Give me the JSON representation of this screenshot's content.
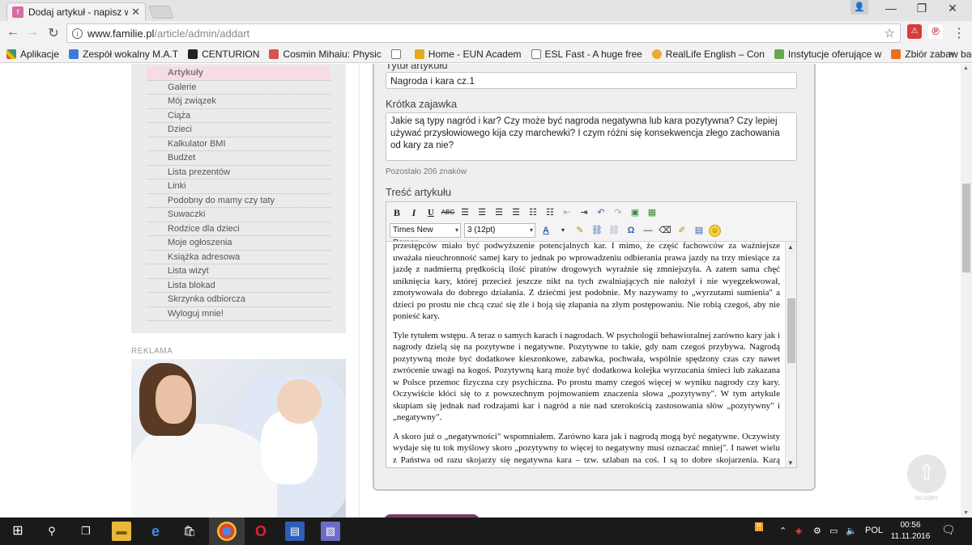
{
  "browser": {
    "tab_title": "Dodaj artykuł - napisz wł",
    "url_host": "www.familie.pl",
    "url_path": "/article/admin/addart",
    "bookmarks": [
      {
        "label": "Aplikacje",
        "color": "#e0513c"
      },
      {
        "label": "Zespół wokalny M.A.T",
        "color": "#3d7bd9"
      },
      {
        "label": "CENTURION",
        "color": "#222222"
      },
      {
        "label": "Cosmin Mihaiu: Physic",
        "color": "#d9534f"
      },
      {
        "label": "",
        "color": "#ffffff"
      },
      {
        "label": "Home - EUN Academ",
        "color": "#e6a91c"
      },
      {
        "label": "ESL Fast - A huge free",
        "color": "#ffffff"
      },
      {
        "label": "RealLife English – Con",
        "color": "#f0a73a"
      },
      {
        "label": "Instytucje oferujące w",
        "color": "#6aa84f"
      },
      {
        "label": "Zbiór zabaw badawcz",
        "color": "#e8711f"
      }
    ],
    "bookmarks_more": "»"
  },
  "sidebar": {
    "items": [
      {
        "label": "Artykuły",
        "active": true
      },
      {
        "label": "Galerie"
      },
      {
        "label": "Mój związek"
      },
      {
        "label": "Ciąża"
      },
      {
        "label": "Dzieci"
      },
      {
        "label": "Kalkulator BMI"
      },
      {
        "label": "Budżet"
      },
      {
        "label": "Lista prezentów"
      },
      {
        "label": "Linki"
      },
      {
        "label": "Podobny do mamy czy taty"
      },
      {
        "label": "Suwaczki"
      },
      {
        "label": "Rodzice dla dzieci"
      },
      {
        "label": "Moje ogłoszenia"
      },
      {
        "label": "Książka adresowa"
      },
      {
        "label": "Lista wizyt"
      },
      {
        "label": "Lista blokad"
      },
      {
        "label": "Skrzynka odbiorcza"
      },
      {
        "label": "Wyloguj mnie!"
      }
    ],
    "ad_label": "REKLAMA"
  },
  "form": {
    "title_label": "Tytuł artykułu",
    "title_value": "Nagroda i kara cz.1",
    "teaser_label": "Krótka zajawka",
    "teaser_value": "Jakie są typy nagród i kar? Czy może być nagroda negatywna lub kara pozytywna? Czy lepiej używać przysłowiowego kija czy marchewki? I czym różni się konsekwencja złego zachowania od kary za nie?",
    "counter": "Pozostało 206 znaków",
    "content_label": "Treść artykułu",
    "font_family": "Times New Roman",
    "font_size": "3 (12pt)",
    "paragraphs": [
      "przestępców miało być podwyższenie potencjalnych kar. I mimo, że część fachowców za ważniejsze uważała nieuchronność samej kary to jednak po wprowadzeniu odbierania prawa jazdy na trzy miesiące za jazdę z nadmierną prędkością ilość piratów drogowych wyraźnie się zmniejszyła. A zatem sama chęć uniknięcia kary, której przecież jeszcze nikt na tych zwalniających nie nałożył i nie wyegzekwował, zmotywowała do dobrego działania. Z dziećmi jest podobnie. My nazywamy to „wyrzutami sumienia\" a dzieci po prostu nie chcą czuć się źle i boją się złapania na złym postępowaniu. Nie robią czegoś, aby nie ponieść kary.",
      "Tyle tytułem wstępu. A teraz o samych karach i nagrodach. W psychologii behawioralnej zarówno kary jak i nagrody dzielą się na pozytywne i negatywne. Pozytywne to takie, gdy nam czegoś przybywa. Nagrodą pozytywną może być dodatkowe kieszonkowe, zabawka, pochwała, wspólnie spędzony czas czy nawet zwrócenie uwagi na kogoś. Pozytywną karą może być dodatkowa kolejka wyrzucania śmieci lub zakazana w Polsce przemoc fizyczna czy psychiczna. Po prostu mamy czegoś więcej w wyniku nagrody czy kary. Oczywiście kłóci się to z powszechnym pojmowaniem znaczenia słowa „pozytywny\". W tym artykule skupiam się jednak nad rodzajami kar i nagród a nie nad szerokością zastosowania słów „pozytywny\" i „negatywny\".",
      "A skoro już o „negatywności\" wspomniałem. Zarówno kara jak i nagrodą mogą być negatywne. Oczywisty wydaje się tu tok myślowy skoro „pozytywny to więcej to negatywny musi oznaczać mniej\". I nawet wielu z Państwa od razu skojarzy się negatywna kara – tzw. szlaban na coś. I są to dobre skojarzenia. Karą negatywną będą wszystkie ograniczenia w odwiedzaniu kolegów, w"
    ]
  },
  "to_top_label": "DO GÓRY",
  "taskbar": {
    "language": "POL",
    "time": "00:56",
    "date": "11.11.2016"
  }
}
